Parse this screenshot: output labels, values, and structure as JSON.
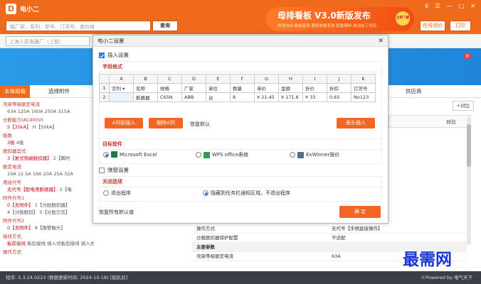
{
  "app": {
    "title": "电小二",
    "logo": "D"
  },
  "search": {
    "placeholder": "输厂家、系列、型号、订货号、查价格",
    "button": "查询"
  },
  "banner": {
    "title": "母排看板 V3.0新版发布",
    "subtitle": "快速自由 看板图表 图纸参数查询 智能算料 自动加工代码",
    "badge": "立即了解"
  },
  "toolbar": {
    "online_price": "在线询价",
    "print": "打印"
  },
  "address": {
    "placeholder": "上海人民电器厂（上联）"
  },
  "left_tabs": [
    "本体规格",
    "选择附件"
  ],
  "params": [
    {
      "name": "壳架等级额定电流",
      "values": "63A  125A  160A  250A  315A"
    },
    {
      "name": "分断能力(AC400V)",
      "selected": "S【35kA】",
      "values": " H【50kA】"
    },
    {
      "name": "极数",
      "selected": "3极",
      "values": " 4极"
    },
    {
      "name": "脱扣器型式",
      "selected": "3【复式热磁脱扣器】",
      "values": " 2【瞬时"
    },
    {
      "name": "额定电流",
      "values": "10A  12.5A  16A  20A  25A  32A"
    },
    {
      "name": "用途代号",
      "selected": "无代号【配电用断路器】",
      "values": " 2【电"
    },
    {
      "name": "附件代号1",
      "selected": "0【无附件】",
      "values": " 1【分励脱扣器】"
    },
    {
      "name": "",
      "values": "4【分励脱扣】 5【分励欠压】"
    },
    {
      "name": "附件代号2",
      "selected": "0【无附件】",
      "values": " 8【报警触头】"
    },
    {
      "name": "接线方式",
      "selected": "板前接线",
      "values": " 板后接线  插入式板后接线  插入式板前接线"
    },
    {
      "name": "操作方式",
      "values": ""
    }
  ],
  "right_tabs": [
    "供应商"
  ],
  "right": {
    "contrast_button": "+对比",
    "contrast_label": "对比"
  },
  "spec": [
    {
      "k": "操作方式",
      "v": "无代号【手柄直接操作】",
      "head": false
    },
    {
      "k": "过载脱扣器保护配置",
      "v": "不适配",
      "head": false
    },
    {
      "k": "主要参数",
      "v": "",
      "head": true
    },
    {
      "k": "壳架等级额定电流",
      "v": "63A",
      "head": false
    }
  ],
  "status": {
    "left": "程序: 5.3.24.0223  (数据更新时间: 2024-10-18)    [如此此]",
    "right": "©Powered by 电气天下"
  },
  "watermark": "最需网",
  "modal": {
    "title": "电小二设置",
    "insert_settings": "插入设置",
    "field_format": "字段格式",
    "columns": [
      "",
      "A",
      "B",
      "C",
      "D",
      "E",
      "F",
      "G",
      "H",
      "I",
      "J",
      "K"
    ],
    "row1": [
      "1",
      "空列",
      "名称",
      "规格",
      "厂家",
      "单位",
      "数量",
      "单价",
      "金额",
      "折价",
      "折扣",
      "订货号"
    ],
    "row2": [
      "2",
      "",
      "断路器",
      "C65N",
      "ABB",
      "台",
      "8",
      "¥ 21.45",
      "¥ 171.6",
      "¥ 33",
      "0.65",
      "No123"
    ],
    "btn_insert_col": "A列前插入",
    "btn_delete_col": "删除A列",
    "restore_default": "恢复默认",
    "btn_header_insert": "表头插入",
    "target_software": "目标软件",
    "software": [
      "Microsoft Excel",
      "WPS office表格",
      "ExWinner报价"
    ],
    "popup_settings": "弹窗设置",
    "close_options": "关闭选项",
    "close_choices": [
      "退出程序",
      "隐藏到任务栏通知区域，不退出程序"
    ],
    "restore_all_default": "恢复所有默认值",
    "confirm": "确 定"
  }
}
